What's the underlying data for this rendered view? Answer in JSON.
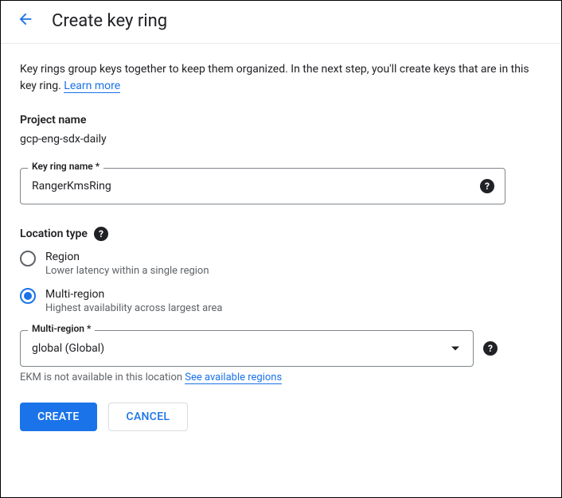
{
  "header": {
    "title": "Create key ring"
  },
  "description": {
    "text": "Key rings group keys together to keep them organized. In the next step, you'll create keys that are in this key ring. ",
    "link": "Learn more"
  },
  "project": {
    "label": "Project name",
    "value": "gcp-eng-sdx-daily"
  },
  "keyRingName": {
    "label": "Key ring name *",
    "value": "RangerKmsRing"
  },
  "locationType": {
    "label": "Location type",
    "options": [
      {
        "title": "Region",
        "description": "Lower latency within a single region",
        "selected": false
      },
      {
        "title": "Multi-region",
        "description": "Highest availability across largest area",
        "selected": true
      }
    ]
  },
  "multiRegion": {
    "label": "Multi-region *",
    "value": "global (Global)",
    "helperText": "EKM is not available in this location ",
    "helperLink": "See available regions"
  },
  "buttons": {
    "create": "Create",
    "cancel": "Cancel"
  }
}
